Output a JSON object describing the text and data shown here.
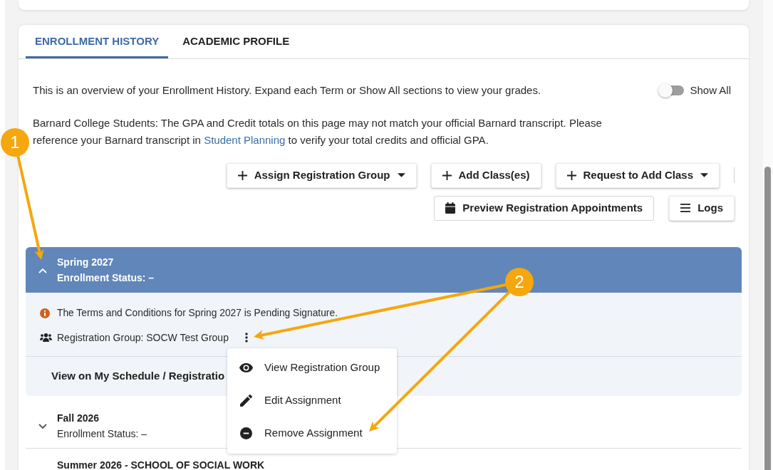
{
  "tabs": [
    {
      "label": "ENROLLMENT HISTORY",
      "selected": true
    },
    {
      "label": "ACADEMIC PROFILE",
      "selected": false
    }
  ],
  "intro": {
    "text": "This is an overview of your Enrollment History. Expand each Term or Show All sections to view your grades.",
    "show_all": {
      "label": "Show All",
      "on": false
    }
  },
  "notice": {
    "before": "Barnard College Students: The GPA and Credit totals on this page may not match your official Barnard transcript. Please reference your Barnard transcript in ",
    "link": "Student Planning",
    "after": " to verify your total credits and official GPA."
  },
  "action_rows": [
    [
      {
        "label": "Assign Registration Group",
        "dropdown": true,
        "kind": "raised"
      },
      {
        "label": "Add Class(es)",
        "dropdown": false,
        "kind": "raised"
      },
      {
        "label": "Request to Add Class",
        "dropdown": true,
        "kind": "raised"
      }
    ],
    [
      {
        "label": "Preview Registration Appointments",
        "dropdown": false,
        "kind": "outlined"
      },
      {
        "label": "Logs",
        "dropdown": false,
        "kind": "raised"
      }
    ]
  ],
  "terms": [
    {
      "title": "Spring 2027",
      "status": "Enrollment Status: –",
      "expanded": true,
      "notice": "The Terms and Conditions for Spring 2027 is Pending Signature.",
      "group": "Registration Group: SOCW Test Group",
      "schedule_link": "View on My Schedule / Registratio",
      "menu": {
        "open": true,
        "items": [
          {
            "label": "View Registration Group"
          },
          {
            "label": "Edit Assignment"
          },
          {
            "label": "Remove Assignment"
          }
        ]
      }
    },
    {
      "title": "Fall 2026",
      "status": "Enrollment Status: –",
      "expanded": false
    },
    {
      "title": "Summer 2026 - SCHOOL OF SOCIAL WORK"
    }
  ],
  "callouts": [
    {
      "label": "1"
    },
    {
      "label": "2"
    }
  ]
}
